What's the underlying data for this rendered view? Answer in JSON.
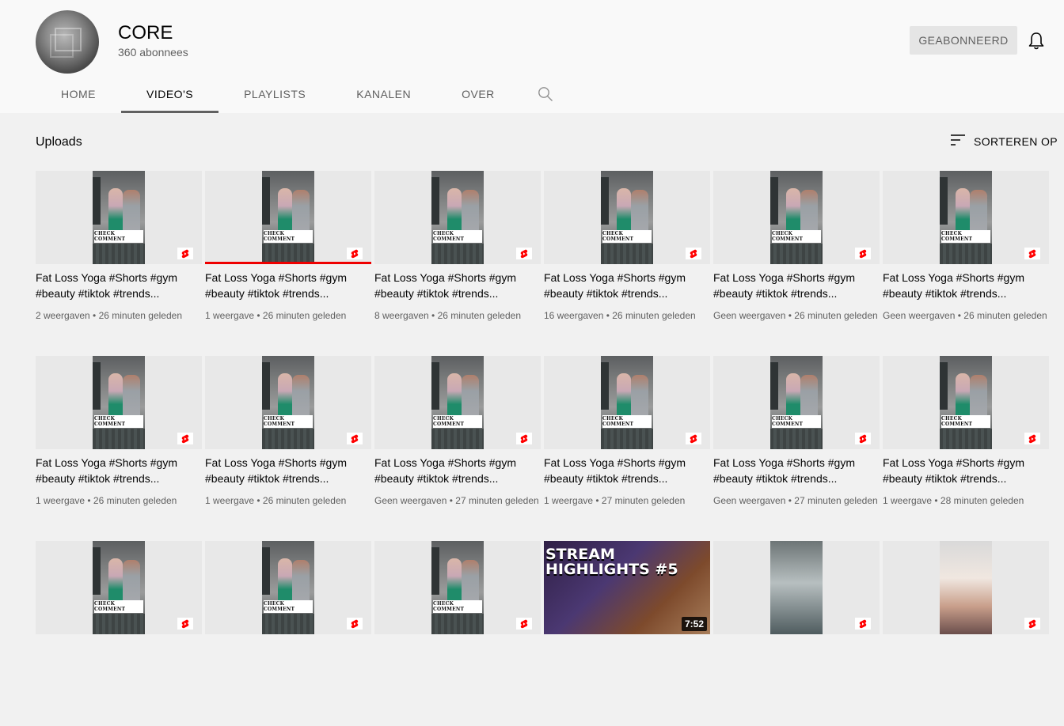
{
  "channel": {
    "name": "CORE",
    "subscribers": "360 abonnees",
    "subscribe_label": "GEABONNEERD",
    "bell_icon": "bell-icon"
  },
  "tabs": [
    {
      "label": "HOME",
      "active": false
    },
    {
      "label": "VIDEO'S",
      "active": true
    },
    {
      "label": "PLAYLISTS",
      "active": false
    },
    {
      "label": "KANALEN",
      "active": false
    },
    {
      "label": "OVER",
      "active": false
    }
  ],
  "section": {
    "title": "Uploads",
    "sort_label": "SORTEREN OP"
  },
  "videos": [
    {
      "title": "Fat Loss Yoga #Shorts #gym #beauty #tiktok #trends...",
      "meta": "2 weergaven • 26 minuten geleden",
      "thumb_text": "CHECK COMMENT",
      "watched": 0
    },
    {
      "title": "Fat Loss Yoga #Shorts #gym #beauty #tiktok #trends...",
      "meta": "1 weergave • 26 minuten geleden",
      "thumb_text": "CHECK COMMENT",
      "watched": 1
    },
    {
      "title": "Fat Loss Yoga #Shorts #gym #beauty #tiktok #trends...",
      "meta": "8 weergaven • 26 minuten geleden",
      "thumb_text": "CHECK COMMENT",
      "watched": 0
    },
    {
      "title": "Fat Loss Yoga #Shorts #gym #beauty #tiktok #trends...",
      "meta": "16 weergaven • 26 minuten geleden",
      "thumb_text": "CHECK COMMENT",
      "watched": 0
    },
    {
      "title": "Fat Loss Yoga #Shorts #gym #beauty #tiktok #trends...",
      "meta": "Geen weergaven • 26 minuten geleden",
      "thumb_text": "CHECK COMMENT",
      "watched": 0
    },
    {
      "title": "Fat Loss Yoga #Shorts #gym #beauty #tiktok #trends...",
      "meta": "Geen weergaven • 26 minuten geleden",
      "thumb_text": "CHECK COMMENT",
      "watched": 0
    },
    {
      "title": "Fat Loss Yoga #Shorts #gym #beauty #tiktok #trends...",
      "meta": "1 weergave • 26 minuten geleden",
      "thumb_text": "CHECK COMMENT",
      "watched": 0
    },
    {
      "title": "Fat Loss Yoga #Shorts #gym #beauty #tiktok #trends...",
      "meta": "1 weergave • 26 minuten geleden",
      "thumb_text": "CHECK COMMENT",
      "watched": 0
    },
    {
      "title": "Fat Loss Yoga #Shorts #gym #beauty #tiktok #trends...",
      "meta": "Geen weergaven • 27 minuten geleden",
      "thumb_text": "CHECK COMMENT",
      "watched": 0
    },
    {
      "title": "Fat Loss Yoga #Shorts #gym #beauty #tiktok #trends...",
      "meta": "1 weergave • 27 minuten geleden",
      "thumb_text": "CHECK COMMENT",
      "watched": 0
    },
    {
      "title": "Fat Loss Yoga #Shorts #gym #beauty #tiktok #trends...",
      "meta": "Geen weergaven • 27 minuten geleden",
      "thumb_text": "CHECK COMMENT",
      "watched": 0
    },
    {
      "title": "Fat Loss Yoga #Shorts #gym #beauty #tiktok #trends...",
      "meta": "1 weergave • 28 minuten geleden",
      "thumb_text": "CHECK COMMENT",
      "watched": 0
    },
    {
      "title": "",
      "meta": "",
      "thumb_text": "CHECK COMMENT",
      "watched": 0
    },
    {
      "title": "",
      "meta": "",
      "thumb_text": "CHECK COMMENT",
      "watched": 0
    },
    {
      "title": "",
      "meta": "",
      "thumb_text": "CHECK COMMENT",
      "watched": 0
    },
    {
      "title": "",
      "meta": "",
      "thumb_text": "STREAM HIGHLIGHTS #5",
      "duration": "7:52",
      "stream": true,
      "watched": 0
    },
    {
      "title": "",
      "meta": "",
      "thumb_text": "",
      "variant": "a",
      "watched": 0
    },
    {
      "title": "",
      "meta": "",
      "thumb_text": "",
      "variant": "b",
      "watched": 0
    }
  ],
  "colors": {
    "accent_red": "#ee0000",
    "header_bg": "#f9f9f9",
    "page_bg": "#f1f1f1",
    "secondary_text": "#606060"
  }
}
